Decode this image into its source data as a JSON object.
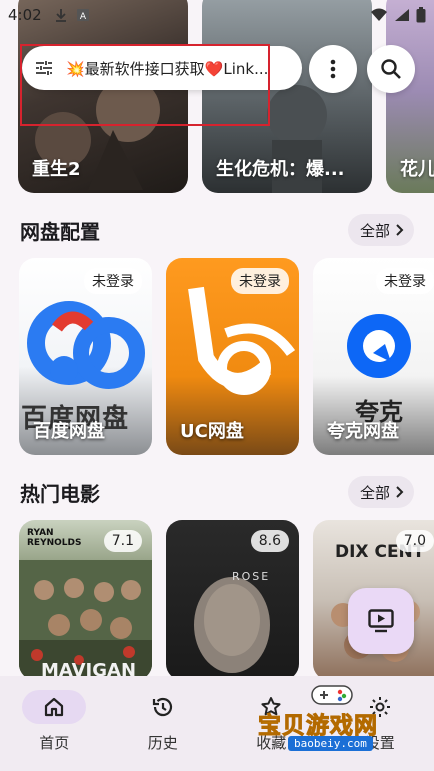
{
  "status_bar": {
    "time": "4:02"
  },
  "search": {
    "text": "💥最新软件接口获取❤️Link..."
  },
  "top_banners": [
    {
      "title": "重生2"
    },
    {
      "title": "生化危机：爆..."
    },
    {
      "title": "花儿"
    }
  ],
  "cloud_section": {
    "title": "网盘配置",
    "all_label": "全部",
    "items": [
      {
        "name": "百度网盘",
        "status": "未登录",
        "logo_text": "百度网盘"
      },
      {
        "name": "UC网盘",
        "status": "未登录"
      },
      {
        "name": "夸克网盘",
        "status": "未登录",
        "logo_text": "夸克"
      }
    ]
  },
  "movie_section": {
    "title": "热门电影",
    "all_label": "全部",
    "items": [
      {
        "rating": "7.1",
        "poster_top": "RYAN REYNOLDS",
        "poster_bottom": "MAVIGAN"
      },
      {
        "rating": "8.6",
        "poster_top": "ROSE"
      },
      {
        "rating": "7.0",
        "poster_top": "DIX CENT"
      }
    ]
  },
  "bottom_nav": {
    "items": [
      {
        "label": "首页",
        "icon": "home-icon",
        "active": true
      },
      {
        "label": "历史",
        "icon": "history-icon",
        "active": false
      },
      {
        "label": "收藏",
        "icon": "favorite-icon",
        "active": false
      },
      {
        "label": "设置",
        "icon": "settings-icon",
        "active": false
      }
    ]
  },
  "watermark": {
    "text": "宝贝游戏网",
    "url": "baobeiy.com"
  },
  "colors": {
    "accent": "#e6d9f2",
    "highlight_box": "#d6232e",
    "fab_bg": "#ead9f6"
  }
}
